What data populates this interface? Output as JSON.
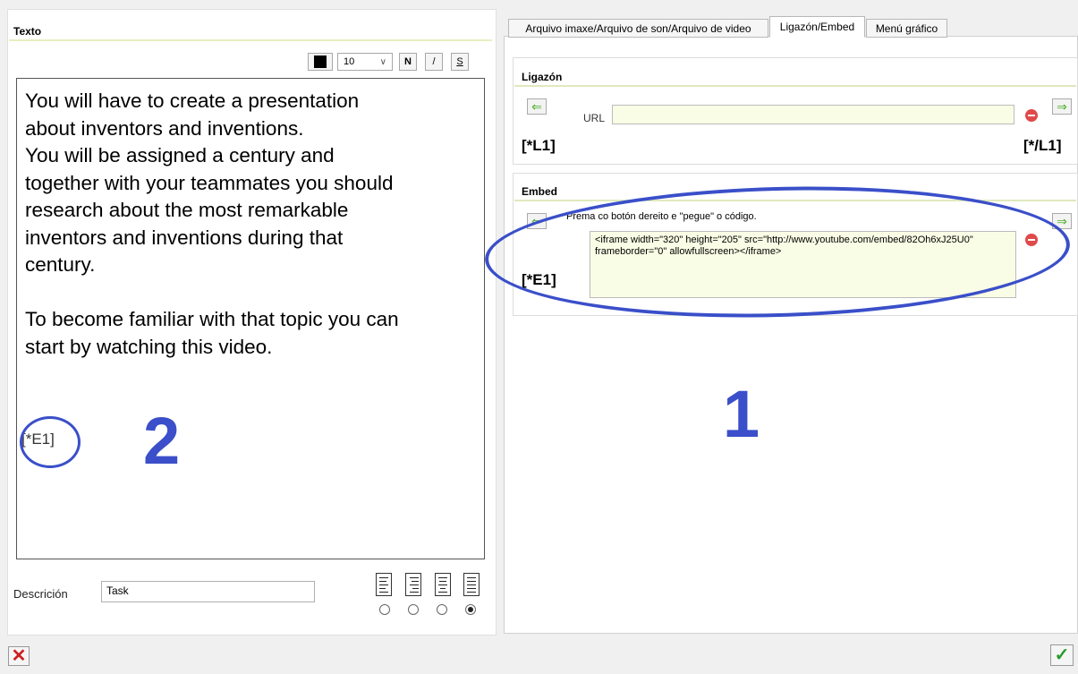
{
  "left": {
    "title": "Texto",
    "toolbar": {
      "font_size": "10",
      "bold": "N",
      "italic": "/",
      "strike": "S",
      "dropdown_arrow": "∨"
    },
    "text_lines": [
      "You will have to create a presentation",
      "about inventors and inventions.",
      "You will be assigned a century and",
      "together with your teammates you should",
      "research about the most remarkable",
      "inventors and inventions during that",
      "century.",
      "",
      "To become familiar with that topic you can",
      "start by watching this video."
    ],
    "embed_marker": "[*E1]",
    "annotation": "2",
    "description_label": "Descrición",
    "description_value": "Task",
    "alignment_selected_index": 3
  },
  "tabs": [
    {
      "label": "Arquivo imaxe/Arquivo de son/Arquivo de video"
    },
    {
      "label": "Ligazón/Embed"
    },
    {
      "label": "Menú gráfico"
    }
  ],
  "link_section": {
    "title": "Ligazón",
    "url_label": "URL",
    "url_value": "",
    "start_marker": "[*L1]",
    "end_marker": "[*/L1]"
  },
  "embed_section": {
    "title": "Embed",
    "hint": "Prema co botón dereito e \"pegue\" o código.",
    "code": "<iframe width=\"320\" height=\"205\" src=\"http://www.youtube.com/embed/82Oh6xJ25U0\" frameborder=\"0\" allowfullscreen></iframe>",
    "marker": "[*E1]",
    "annotation": "1"
  },
  "colors": {
    "annotation": "#3a4fc9",
    "field_bg": "#fafde5",
    "section_line": "#dfe9bd"
  }
}
